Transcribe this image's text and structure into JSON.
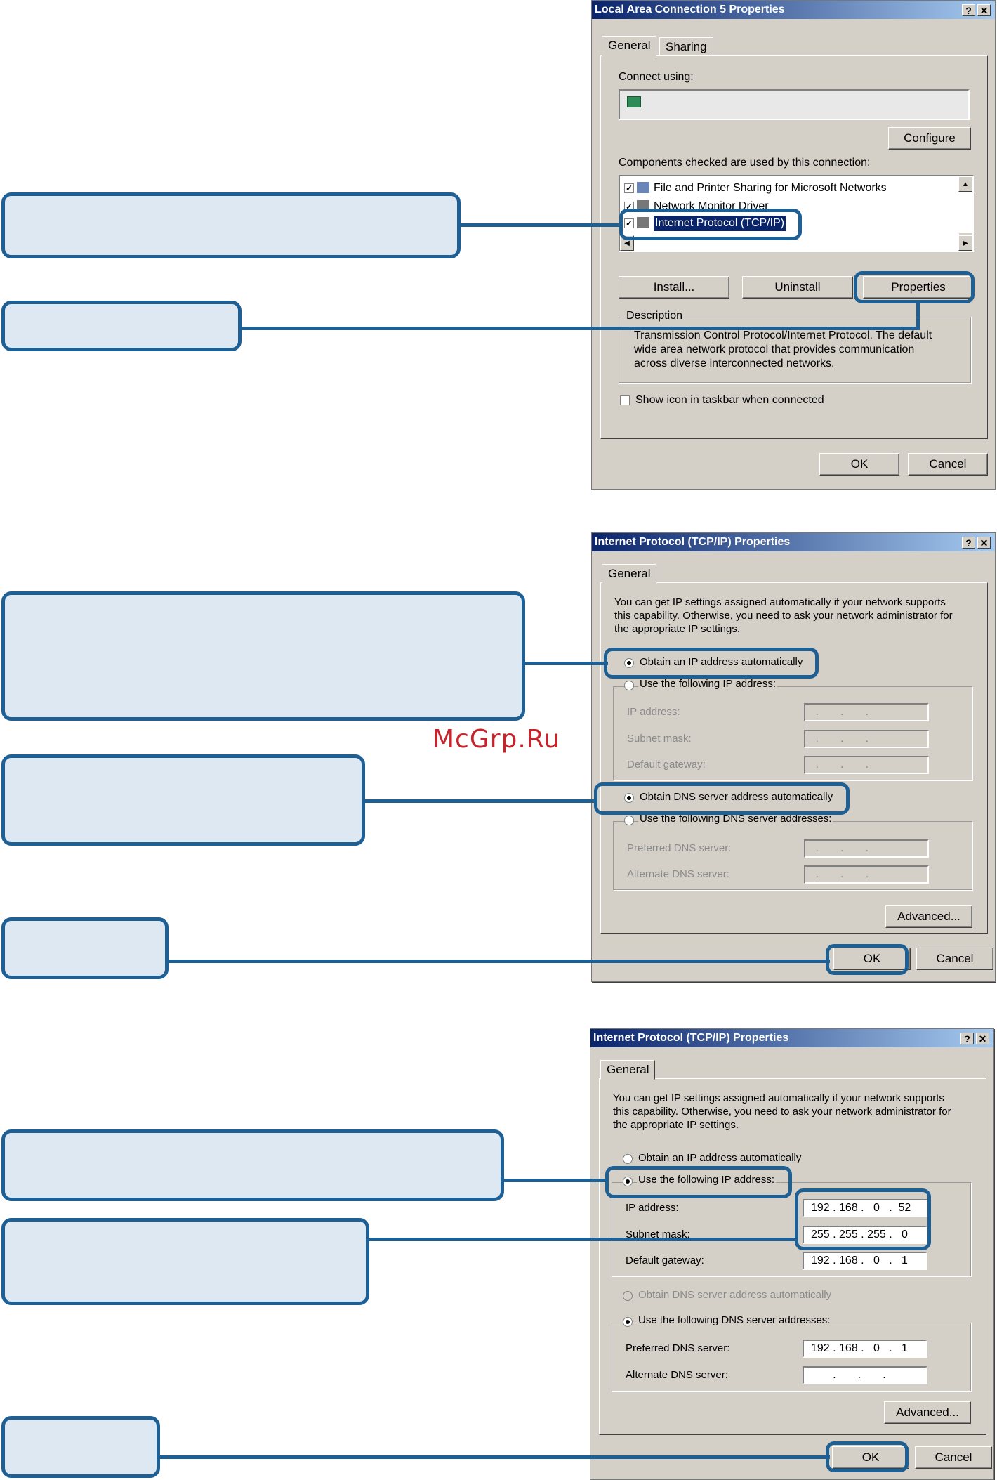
{
  "watermark": "McGrp.Ru",
  "dialog1": {
    "title": "Local Area Connection 5 Properties",
    "help_btn": "?",
    "close_btn": "✕",
    "tabs": [
      "General",
      "Sharing"
    ],
    "connect_using_label": "Connect using:",
    "configure_label": "Configure",
    "components_label": "Components checked are used by this connection:",
    "components": [
      "File and Printer Sharing for Microsoft Networks",
      "Network Monitor Driver",
      "Internet Protocol (TCP/IP)"
    ],
    "install_label": "Install...",
    "uninstall_label": "Uninstall",
    "properties_label": "Properties",
    "description_label": "Description",
    "description_lines": [
      "Transmission Control Protocol/Internet Protocol. The default",
      "wide area network protocol that provides communication",
      "across diverse interconnected networks."
    ],
    "show_icon_label": "Show icon in taskbar when connected",
    "ok_label": "OK",
    "cancel_label": "Cancel"
  },
  "dialog2": {
    "title": "Internet Protocol (TCP/IP) Properties",
    "help_btn": "?",
    "close_btn": "✕",
    "tab": "General",
    "intro_lines": [
      "You can get IP settings assigned automatically if your network supports",
      "this capability. Otherwise, you need to ask your network administrator for",
      "the appropriate IP settings."
    ],
    "obtain_ip_label": "Obtain an IP address automatically",
    "use_ip_label": "Use the following IP address:",
    "ip_label": "IP address:",
    "subnet_label": "Subnet mask:",
    "gateway_label": "Default gateway:",
    "empty_ip": " .       .       .",
    "obtain_dns_label": "Obtain DNS server address automatically",
    "use_dns_label": "Use the following DNS server addresses:",
    "pref_dns_label": "Preferred DNS server:",
    "alt_dns_label": "Alternate DNS server:",
    "advanced_label": "Advanced...",
    "ok_label": "OK",
    "cancel_label": "Cancel"
  },
  "dialog3": {
    "title": "Internet Protocol (TCP/IP) Properties",
    "help_btn": "?",
    "close_btn": "✕",
    "tab": "General",
    "intro_lines": [
      "You can get IP settings assigned automatically if your network supports",
      "this capability. Otherwise, you need to ask your network administrator for",
      "the appropriate IP settings."
    ],
    "obtain_ip_label": "Obtain an IP address automatically",
    "use_ip_label": "Use the following IP address:",
    "ip_label": "IP address:",
    "ip_value": "192 . 168 .   0   .  52",
    "subnet_label": "Subnet mask:",
    "subnet_value": "255 . 255 . 255 .   0",
    "gateway_label": "Default gateway:",
    "gateway_value": "192 . 168 .   0   .   1",
    "obtain_dns_label": "Obtain DNS server address automatically",
    "use_dns_label": "Use the following DNS server addresses:",
    "pref_dns_label": "Preferred DNS server:",
    "pref_dns_value": "192 . 168 .   0   .   1",
    "alt_dns_label": "Alternate DNS server:",
    "alt_dns_value": "       .       .       .",
    "advanced_label": "Advanced...",
    "ok_label": "OK",
    "cancel_label": "Cancel"
  }
}
